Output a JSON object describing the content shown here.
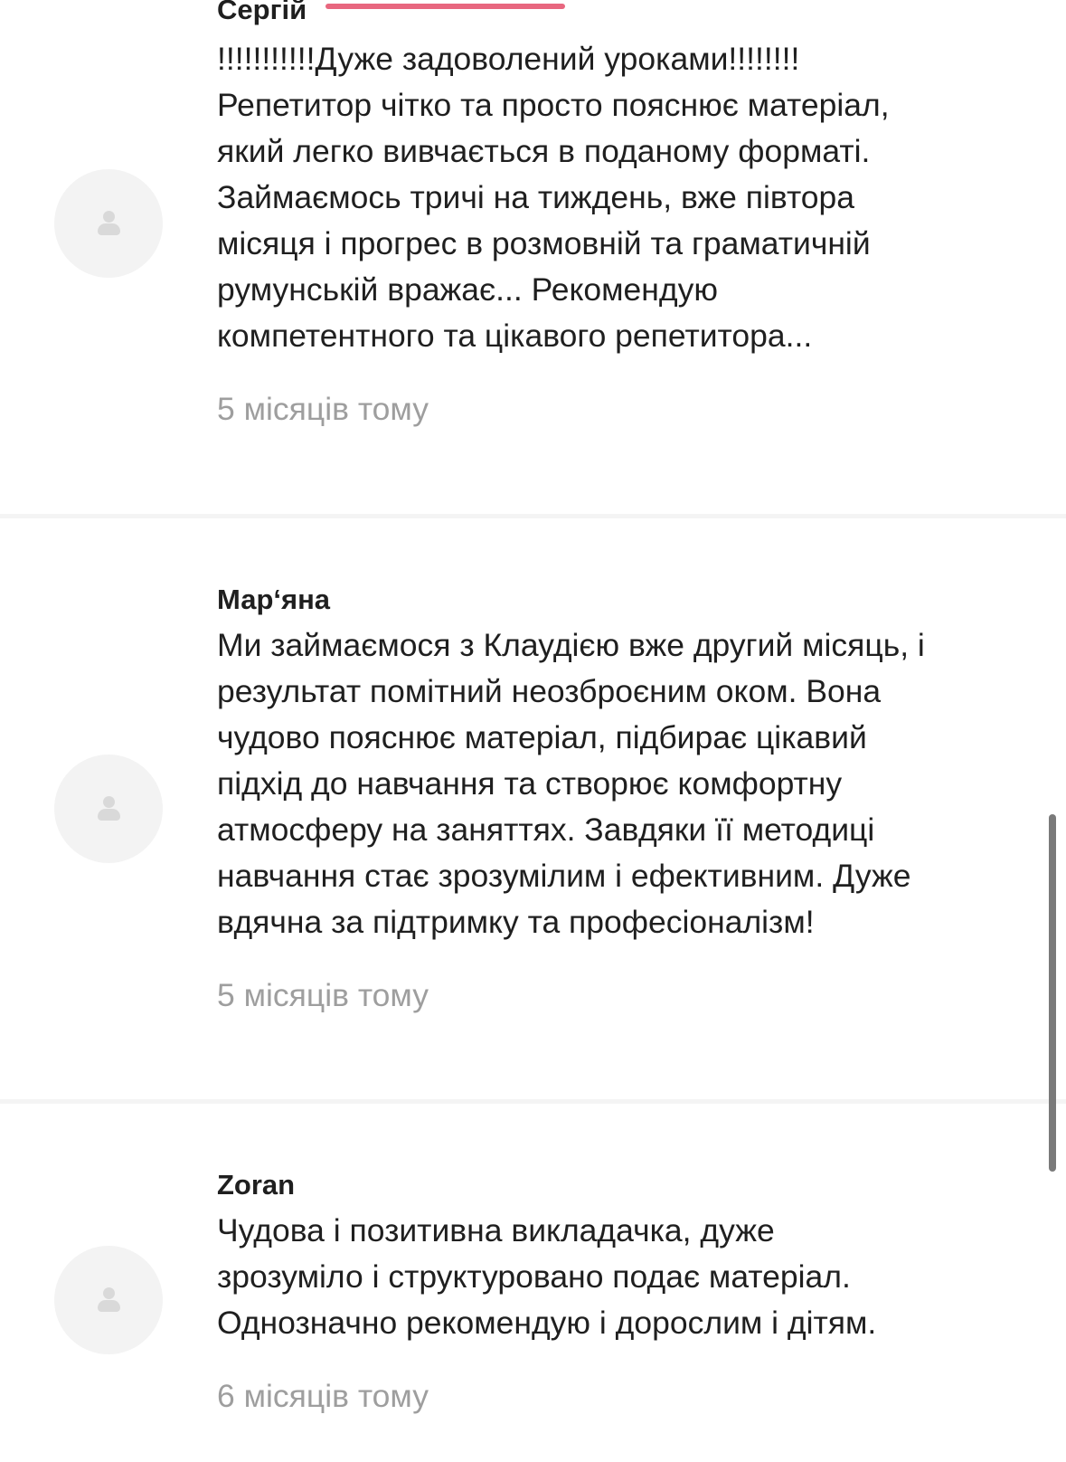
{
  "reviews": [
    {
      "author": "Сергій",
      "lines": [
        "!!!!!!!!!!!Дуже задоволений уроками!!!!!!!!",
        "Репетитор чітко та просто пояснює матеріал,",
        "який легко вивчається в поданому форматі.",
        "Займаємось тричі на тиждень, вже півтора",
        "місяця і прогрес в розмовній та граматичній",
        "румунській вражає... Рекомендую",
        "компетентного та цікавого репетитора..."
      ],
      "date": "5 місяців тому"
    },
    {
      "author": "Мар‘яна",
      "lines": [
        "Ми займаємося з Клаудією вже другий місяць, і",
        "результат помітний неозброєним оком. Вона",
        "чудово пояснює матеріал, підбирає цікавий",
        "підхід до навчання та створює комфортну",
        "атмосферу на заняттях. Завдяки її методиці",
        "навчання стає зрозумілим і ефективним. Дуже",
        "вдячна за підтримку та професіоналізм!"
      ],
      "date": "5 місяців тому"
    },
    {
      "author": "Zoran",
      "lines": [
        "Чудова і позитивна викладачка, дуже",
        "зрозуміло і структуровано подає матеріал.",
        "Однозначно рекомендую і дорослим і дітям."
      ],
      "date": "6 місяців тому"
    }
  ],
  "avatar_icon": "user-placeholder-icon",
  "colors": {
    "accent": "#e8677f",
    "text": "#1f1f1f",
    "muted": "#9e9e9e",
    "avatar_bg": "#f3f3f3",
    "divider": "#f4f4f4"
  }
}
